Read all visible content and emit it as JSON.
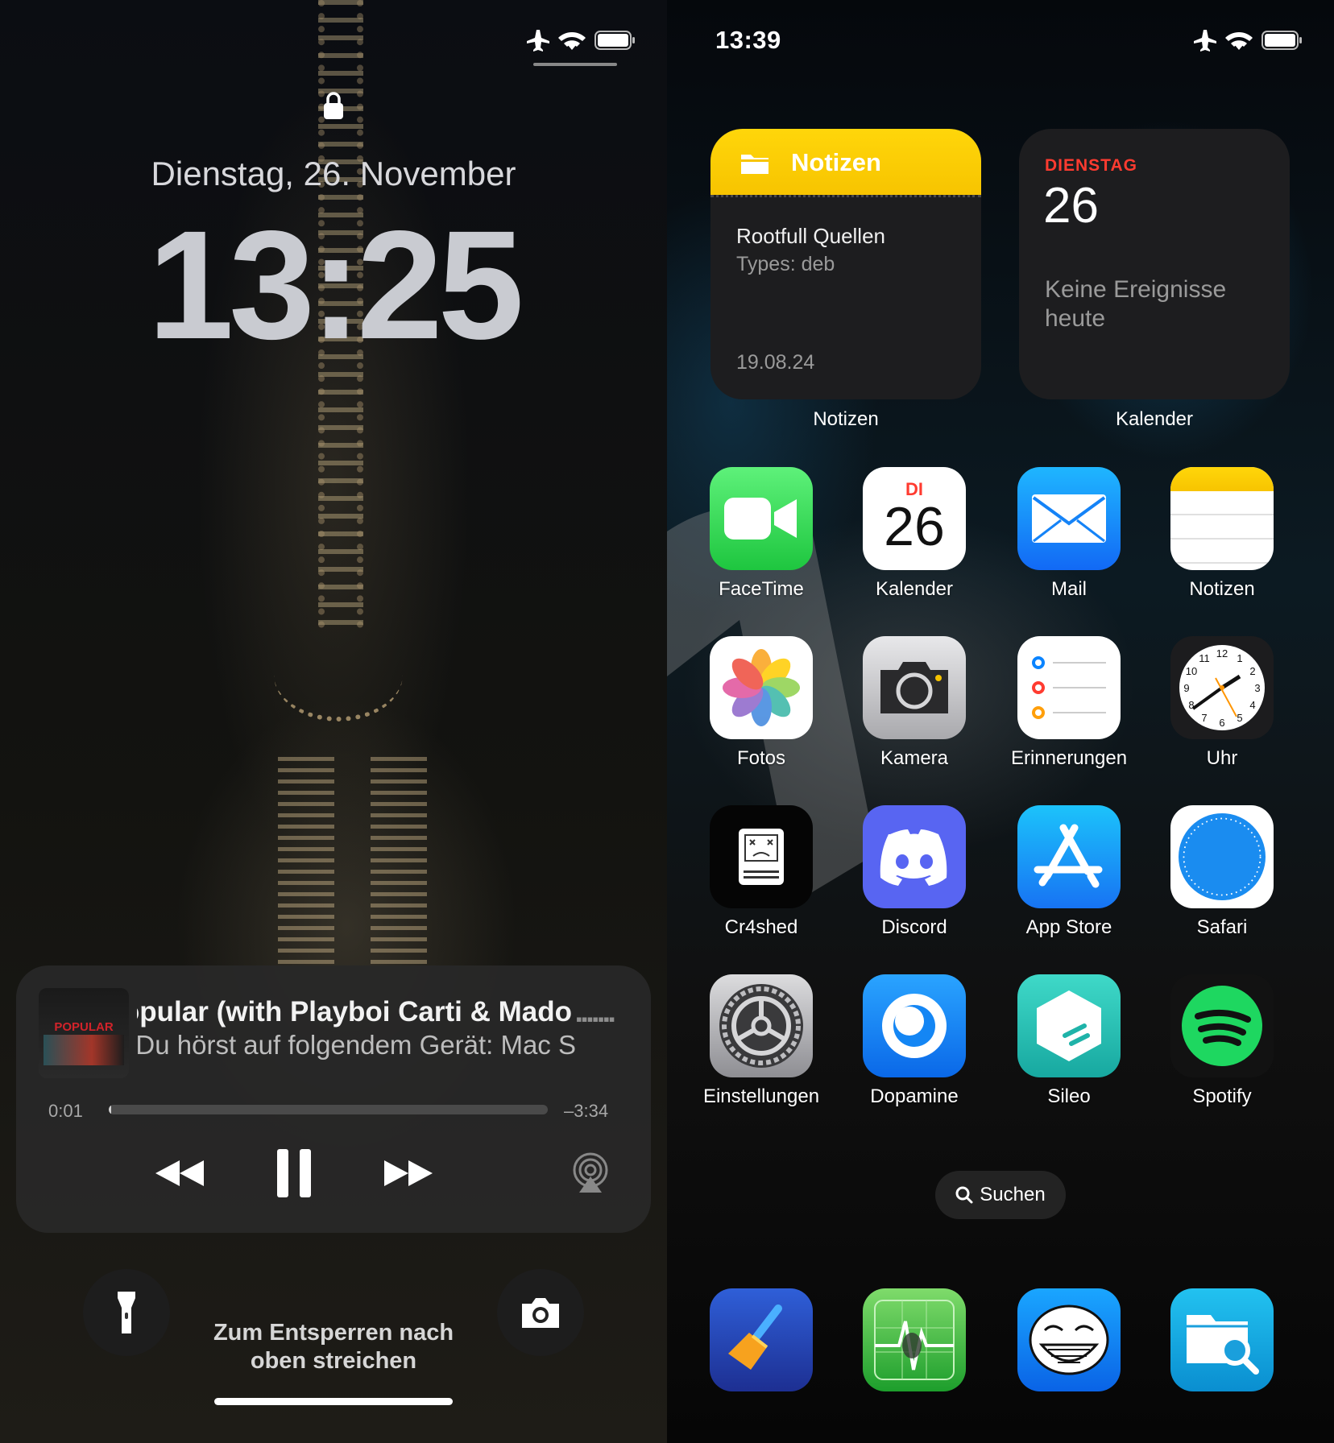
{
  "lock_screen": {
    "date": "Dienstag, 26. November",
    "time": "13:25",
    "now_playing": {
      "track": "Popular (with Playboi Carti & Mado",
      "device": "Du hörst auf folgendem Gerät: Mac S",
      "elapsed": "0:01",
      "remaining": "–3:34",
      "progress": 0.005,
      "album_art_text": "POPULAR"
    },
    "unlock_hint_line1": "Zum Entsperren nach",
    "unlock_hint_line2": "oben streichen"
  },
  "home_screen": {
    "time": "13:39",
    "notes_widget": {
      "header": "Notizen",
      "note_title": "Rootfull Quellen",
      "note_subtitle": "Types: deb",
      "note_date": "19.08.24",
      "label": "Notizen"
    },
    "calendar_widget": {
      "weekday": "DIENSTAG",
      "day": "26",
      "no_events": "Keine Ereignisse heute",
      "label": "Kalender"
    },
    "apps": [
      {
        "label": "FaceTime",
        "icon": "facetime-icon"
      },
      {
        "label": "Kalender",
        "icon": "calendar-icon",
        "weekday": "DI",
        "day": "26"
      },
      {
        "label": "Mail",
        "icon": "mail-icon"
      },
      {
        "label": "Notizen",
        "icon": "notes-icon"
      },
      {
        "label": "Fotos",
        "icon": "photos-icon"
      },
      {
        "label": "Kamera",
        "icon": "camera-icon"
      },
      {
        "label": "Erinnerungen",
        "icon": "reminders-icon"
      },
      {
        "label": "Uhr",
        "icon": "clock-icon"
      },
      {
        "label": "Cr4shed",
        "icon": "crashed-mac-icon"
      },
      {
        "label": "Discord",
        "icon": "discord-icon"
      },
      {
        "label": "App Store",
        "icon": "app-store-icon"
      },
      {
        "label": "Safari",
        "icon": "safari-compass-icon"
      },
      {
        "label": "Einstellungen",
        "icon": "settings-gear-icon"
      },
      {
        "label": "Dopamine",
        "icon": "dopamine-icon"
      },
      {
        "label": "Sileo",
        "icon": "sileo-icon"
      },
      {
        "label": "Spotify",
        "icon": "spotify-icon"
      }
    ],
    "search_label": "Suchen",
    "dock": [
      {
        "icon": "broom-cleaner-icon"
      },
      {
        "icon": "activity-monitor-icon"
      },
      {
        "icon": "trollface-icon"
      },
      {
        "icon": "file-search-icon"
      }
    ]
  },
  "colors": {
    "notes_yellow": "#ffd60a",
    "calendar_red": "#ff3b30",
    "facetime_green": "#34c759",
    "discord_blurple": "#5865f2",
    "spotify_green": "#1ed760"
  }
}
